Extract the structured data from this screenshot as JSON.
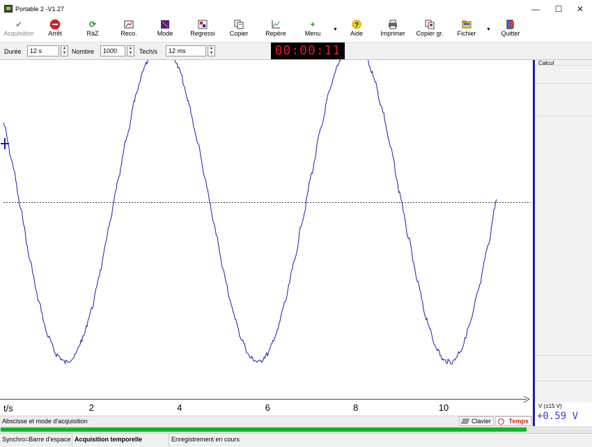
{
  "window": {
    "title": "Portable 2  -V1.27",
    "minimize": "—",
    "maximize": "☐",
    "close": "✕"
  },
  "toolbar": {
    "items": [
      {
        "label": "Acquisition",
        "icon": "checkmark-icon"
      },
      {
        "label": "Arrêt",
        "icon": "stop-sign-icon"
      },
      {
        "label": "RàZ",
        "icon": "refresh-icon"
      },
      {
        "label": "Reco.",
        "icon": "reco-icon"
      },
      {
        "label": "Mode",
        "icon": "mode-icon"
      },
      {
        "label": "Regressi",
        "icon": "regressi-icon"
      },
      {
        "label": "Copier",
        "icon": "copy-icon"
      },
      {
        "label": "Repère",
        "icon": "axes-icon"
      },
      {
        "label": "Menu",
        "icon": "plus-icon"
      },
      {
        "label": "Aide",
        "icon": "help-icon"
      },
      {
        "label": "Imprimer",
        "icon": "printer-icon"
      },
      {
        "label": "Copier gr.",
        "icon": "copy-graph-icon"
      },
      {
        "label": "Fichier",
        "icon": "folder-icon"
      },
      {
        "label": "Quitter",
        "icon": "exit-icon"
      }
    ]
  },
  "params": {
    "duree_label": "Durée",
    "duree_value": "12 s",
    "nombre_label": "Nombre",
    "nombre_value": "1000",
    "techs_label": "Tech/s",
    "techs_value": "12 ms"
  },
  "timer": "00:00:11",
  "plot": {
    "x_axis_label": "t/s"
  },
  "side": {
    "calcul_label": "Calcul",
    "v_label": "V (±15 V)",
    "v_value": "+0.59  V"
  },
  "status_bar": {
    "text": "Abscisse et mode d'acquisition",
    "clavier": "Clavier",
    "temps": "Temps"
  },
  "progress": {
    "fraction": 0.89
  },
  "bottom_status": {
    "synchro": "Synchro=Barre d'espace",
    "mode": "Acquisition temporelle",
    "state": "Enregistrement en cours"
  },
  "colors": {
    "trace": "#1a1ab4",
    "timer_text": "#e41b1b",
    "progress": "#14b428",
    "accent": "#1a1ab4"
  },
  "chart_data": {
    "type": "line",
    "xlabel": "t/s",
    "ylabel": "",
    "x_ticks": [
      2,
      4,
      6,
      8,
      10
    ],
    "xlim": [
      0,
      12
    ],
    "ylim": [
      -1.25,
      1.25
    ],
    "grid": false,
    "baseline": 0,
    "series": [
      {
        "x": [
          0,
          0.2,
          0.4,
          0.6,
          0.8,
          1.0,
          1.2,
          1.4,
          1.6,
          1.8,
          2.0,
          2.2,
          2.4,
          2.6,
          2.8,
          3.0,
          3.2,
          3.4,
          3.6,
          3.8,
          4.0,
          4.2,
          4.4,
          4.6,
          4.8,
          5.0,
          5.2,
          5.4,
          5.6,
          5.8,
          6.0,
          6.2,
          6.4,
          6.6,
          6.8,
          7.0,
          7.2,
          7.4,
          7.6,
          7.8,
          8.0,
          8.2,
          8.4,
          8.6,
          8.8,
          9.0,
          9.2,
          9.4,
          9.6,
          9.8,
          10.0,
          10.2,
          10.4,
          10.6,
          10.8,
          11.0,
          11.2
        ],
        "y": [
          0.5,
          0.25,
          -0.05,
          -0.36,
          -0.62,
          -0.83,
          -0.95,
          -1.0,
          -0.97,
          -0.85,
          -0.67,
          -0.43,
          -0.15,
          0.13,
          0.41,
          0.66,
          0.85,
          0.97,
          1.0,
          0.96,
          0.83,
          0.63,
          0.39,
          0.12,
          -0.16,
          -0.43,
          -0.67,
          -0.85,
          -0.97,
          -1.0,
          -0.95,
          -0.82,
          -0.62,
          -0.38,
          -0.1,
          0.18,
          0.45,
          0.69,
          0.87,
          0.98,
          1.0,
          0.94,
          0.8,
          0.59,
          0.34,
          0.06,
          -0.22,
          -0.49,
          -0.72,
          -0.89,
          -0.99,
          -1.0,
          -0.92,
          -0.76,
          -0.54,
          -0.28,
          0.02
        ]
      }
    ]
  }
}
